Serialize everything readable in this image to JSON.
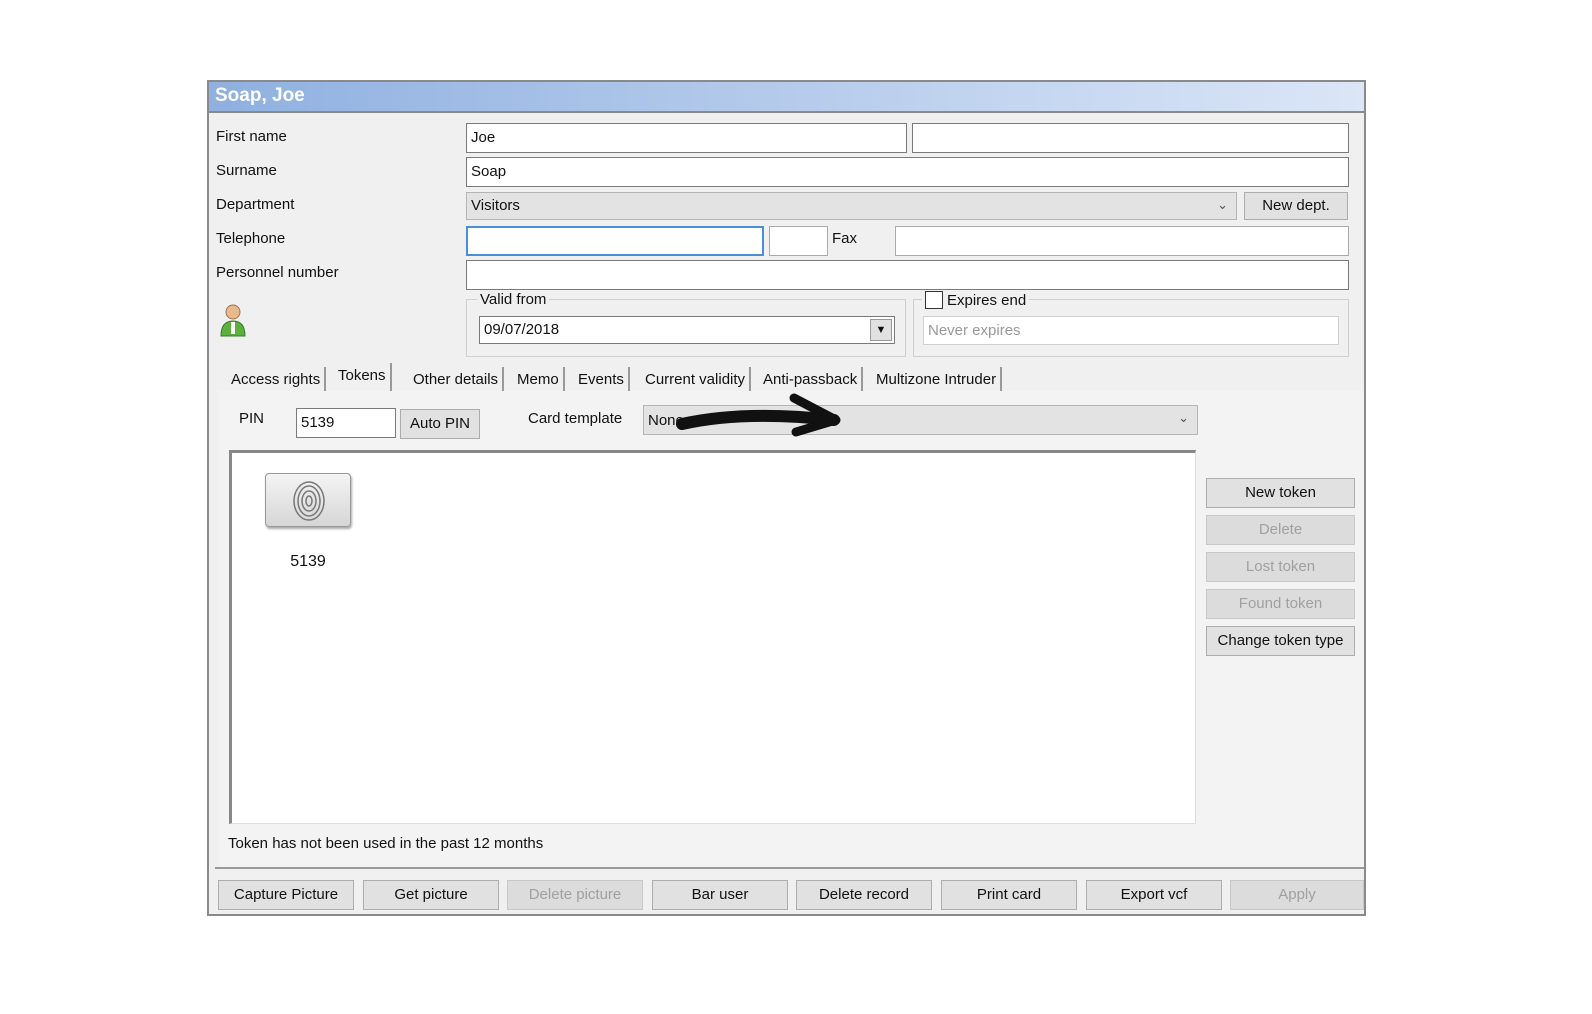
{
  "window": {
    "title": "Soap, Joe"
  },
  "form": {
    "first_name_label": "First name",
    "first_name": "Joe",
    "first_name_extra": "",
    "surname_label": "Surname",
    "surname": "Soap",
    "department_label": "Department",
    "department": "Visitors",
    "new_dept": "New dept.",
    "telephone_label": "Telephone",
    "telephone": "",
    "telephone_ext": "",
    "fax_label": "Fax",
    "fax": "",
    "personnel_label": "Personnel number",
    "personnel": "",
    "valid_from_label": "Valid from",
    "valid_from": "09/07/2018",
    "expires_label": "Expires end",
    "expires_checked": false,
    "expires_value": "Never expires"
  },
  "tabs": [
    {
      "label": "Access rights"
    },
    {
      "label": "Tokens",
      "active": true
    },
    {
      "label": "Other details"
    },
    {
      "label": "Memo"
    },
    {
      "label": "Events"
    },
    {
      "label": "Current validity"
    },
    {
      "label": "Anti-passback"
    },
    {
      "label": "Multizone Intruder"
    }
  ],
  "tokens": {
    "pin_label": "PIN",
    "pin": "5139",
    "auto_pin": "Auto PIN",
    "card_template_label": "Card template",
    "card_template": "None",
    "token_items": [
      {
        "label": "5139",
        "icon": "fingerprint-icon"
      }
    ],
    "buttons": [
      {
        "label": "New token",
        "enabled": true
      },
      {
        "label": "Delete",
        "enabled": false
      },
      {
        "label": "Lost token",
        "enabled": false
      },
      {
        "label": "Found token",
        "enabled": false
      },
      {
        "label": "Change token type",
        "enabled": true
      }
    ],
    "status": "Token has not been used in the past 12 months"
  },
  "footer": [
    {
      "label": "Capture Picture",
      "enabled": true
    },
    {
      "label": "Get picture",
      "enabled": true
    },
    {
      "label": "Delete picture",
      "enabled": false
    },
    {
      "label": "Bar user",
      "enabled": true
    },
    {
      "label": "Delete record",
      "enabled": true
    },
    {
      "label": "Print card",
      "enabled": true
    },
    {
      "label": "Export vcf",
      "enabled": true
    },
    {
      "label": "Apply",
      "enabled": false
    }
  ]
}
